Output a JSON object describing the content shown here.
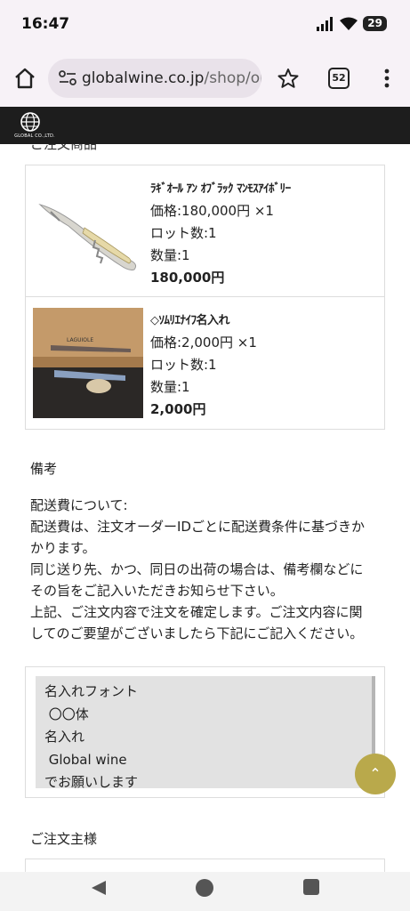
{
  "status": {
    "time": "16:47",
    "battery": "29"
  },
  "browser": {
    "url_domain": "globalwine.co.jp",
    "url_path": "/shop/or",
    "tab_count": "52"
  },
  "site": {
    "logo_text": "GLOBAL CO.,LTD."
  },
  "order": {
    "items": [
      {
        "name": "ﾗｷﾞｵｰﾙ ｱﾝ ｵﾌﾞﾗｯｸ ﾏﾝﾓｽｱｲﾎﾞﾘｰ",
        "price": "価格:180,000円 ×1",
        "lot": "ロット数:1",
        "qty": "数量:1",
        "total": "180,000円"
      },
      {
        "name": "◇ｿﾑﾘｴﾅｲﾌ名入れ",
        "price": "価格:2,000円 ×1",
        "lot": "ロット数:1",
        "qty": "数量:1",
        "total": "2,000円"
      }
    ]
  },
  "remarks": {
    "label": "備考",
    "lines": [
      "配送費について:",
      "配送費は、注文オーダーIDごとに配送費条件に基づきか",
      "かります。",
      "同じ送り先、かつ、同日の出荷の場合は、備考欄などに",
      "その旨をご記入いただきお知らせ下さい。",
      "上記、ご注文内容で注文を確定します。ご注文内容に関",
      "してのご要望がございましたら下記にご記入ください。"
    ],
    "input_value": "名入れフォント\n 〇〇体\n名入れ\n Global wine\nでお願いします"
  },
  "orderer": {
    "label": "ご注文主様"
  }
}
